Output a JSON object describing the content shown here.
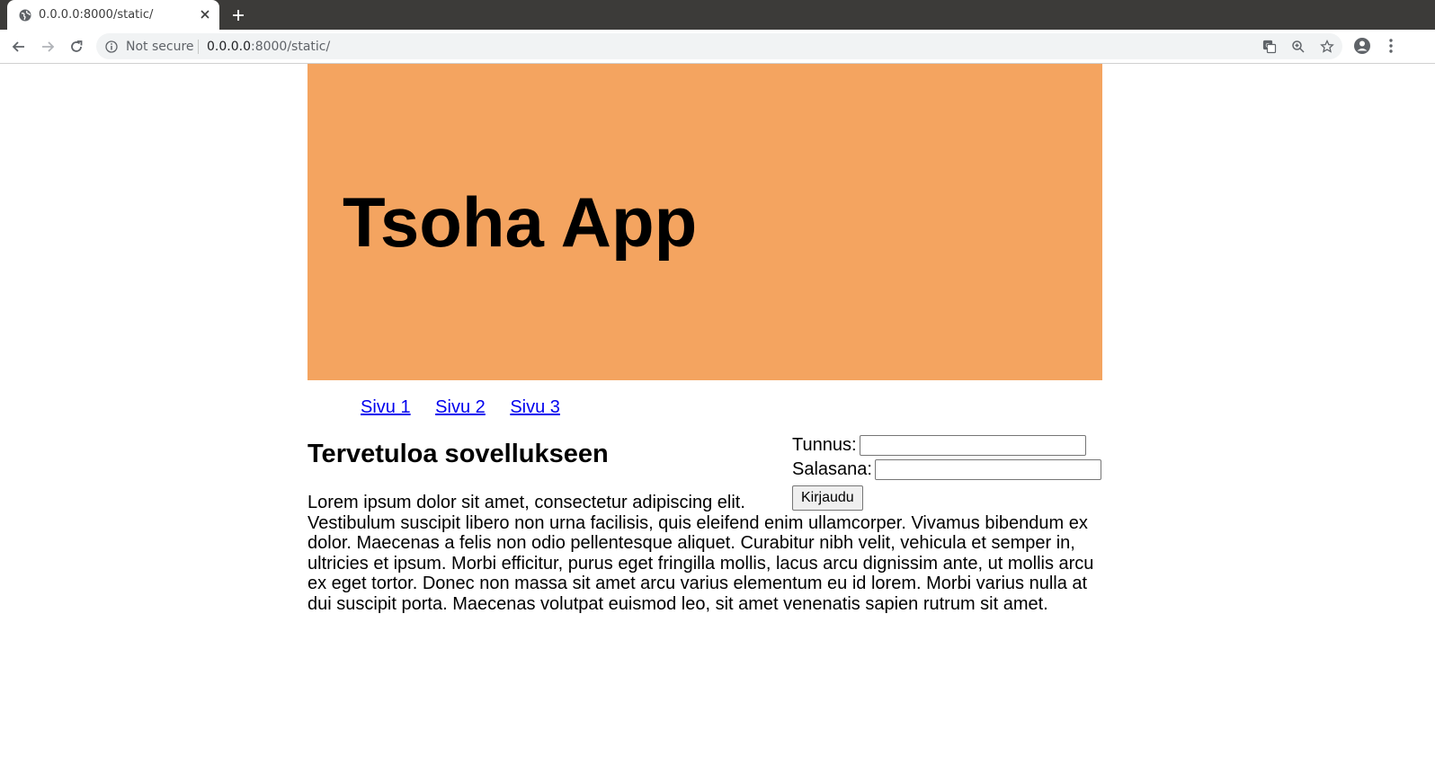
{
  "browser": {
    "tab_title": "0.0.0.0:8000/static/",
    "security_label": "Not secure",
    "url_host": "0.0.0.0",
    "url_path": ":8000/static/"
  },
  "page": {
    "banner_title": "Tsoha App",
    "banner_color": "#f4a460",
    "nav_links": [
      "Sivu 1",
      "Sivu 2",
      "Sivu 3"
    ],
    "heading": "Tervetuloa sovellukseen",
    "body_text_line1": "Lorem ipsum dolor sit amet, consectetur adipiscing elit.",
    "body_text_rest": "Vestibulum suscipit libero non urna facilisis, quis eleifend enim ullamcorper. Vivamus bibendum ex dolor. Maecenas a felis non odio pellentesque aliquet. Curabitur nibh velit, vehicula et semper in, ultricies et ipsum. Morbi efficitur, purus eget fringilla mollis, lacus arcu dignissim ante, ut mollis arcu ex eget tortor. Donec non massa sit amet arcu varius elementum eu id lorem. Morbi varius nulla at dui suscipit porta. Maecenas volutpat euismod leo, sit amet venenatis sapien rutrum sit amet.",
    "login": {
      "username_label": "Tunnus:",
      "username_value": "",
      "password_label": "Salasana:",
      "password_value": "",
      "submit_label": "Kirjaudu"
    }
  }
}
